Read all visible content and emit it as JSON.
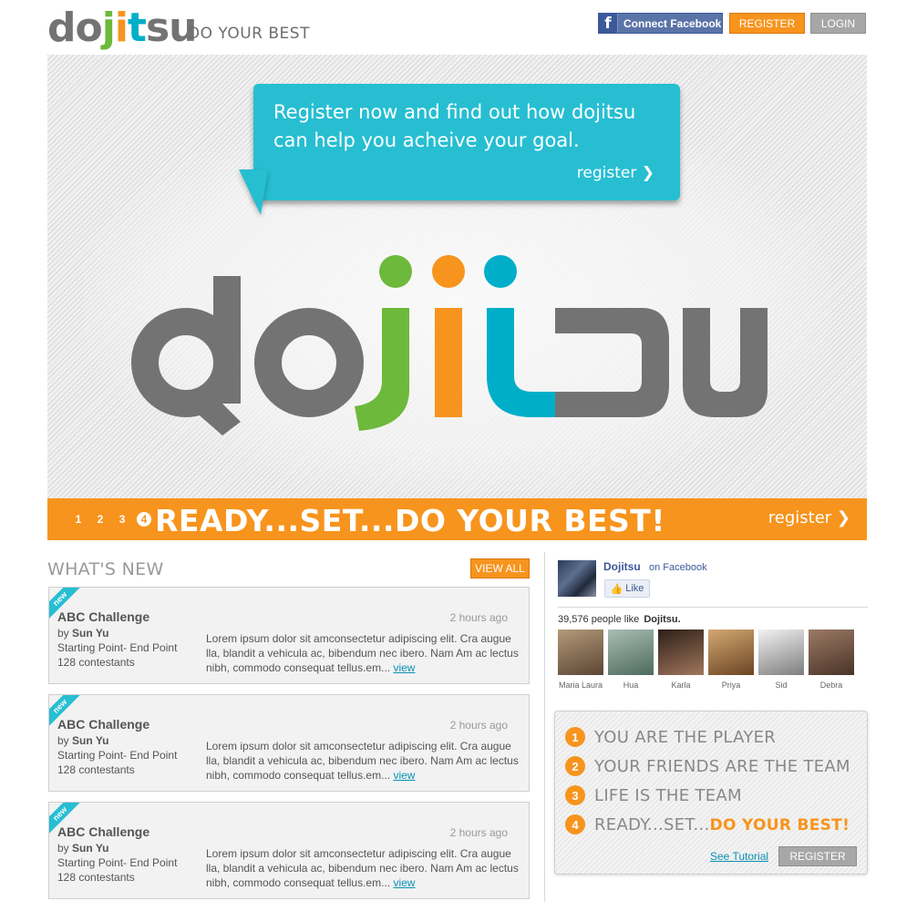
{
  "header": {
    "logo": {
      "d": "do",
      "j": "j",
      "i": "i",
      "t": "t",
      "su": "su"
    },
    "tagline": "DO YOUR BEST",
    "facebook_button": "Connect Facebook",
    "register_button": "REGISTER",
    "login_button": "LOGIN"
  },
  "hero": {
    "bubble_text": "Register now and find out how dojitsu can help you acheive your goal.",
    "bubble_link": "register ❯",
    "big_logo": {
      "do": "do",
      "j": "j",
      "i": "i",
      "t": "t",
      "su": "su"
    },
    "colors": {
      "gray": "#737373",
      "green": "#6cb93b",
      "orange": "#f7941d",
      "blue": "#00aec9"
    }
  },
  "slider": {
    "dots": [
      "1",
      "2",
      "3",
      "4"
    ],
    "active_dot": 4,
    "headline": "READY...SET...DO YOUR BEST!",
    "link": "register ❯"
  },
  "whats_new": {
    "title": "WHAT'S NEW",
    "view_all": "VIEW ALL",
    "items": [
      {
        "badge": "new",
        "title": "ABC Challenge",
        "time": "2 hours ago",
        "by_prefix": "by",
        "author": "Sun Yu",
        "route": "Starting Point- End Point",
        "contestants": "128 contestants",
        "description": "Lorem ipsum dolor sit amconsectetur adipiscing elit. Cra augue lla, blandit a vehicula ac, bibendum nec ibero. Nam Am ac lectus nibh, commodo consequat tellus.em...",
        "view": "view"
      },
      {
        "badge": "new",
        "title": "ABC Challenge",
        "time": "2 hours ago",
        "by_prefix": "by",
        "author": "Sun Yu",
        "route": "Starting Point- End Point",
        "contestants": "128 contestants",
        "description": "Lorem ipsum dolor sit amconsectetur adipiscing elit. Cra augue lla, blandit a vehicula ac, bibendum nec ibero. Nam Am ac lectus nibh, commodo consequat tellus.em...",
        "view": "view"
      },
      {
        "badge": "new",
        "title": "ABC Challenge",
        "time": "2 hours ago",
        "by_prefix": "by",
        "author": "Sun Yu",
        "route": "Starting Point- End Point",
        "contestants": "128 contestants",
        "description": "Lorem ipsum dolor sit amconsectetur adipiscing elit. Cra augue lla, blandit a vehicula ac, bibendum nec ibero. Nam Am ac lectus nibh, commodo consequat tellus.em...",
        "view": "view"
      }
    ]
  },
  "facebook": {
    "page_name": "Dojitsu",
    "on_facebook": "on Facebook",
    "like_button": "Like",
    "likes_count": "39,576 people like",
    "likes_page": "Dojitsu.",
    "friends": [
      {
        "name": "Maria Laura",
        "color": "#8a7358"
      },
      {
        "name": "Hua",
        "color": "#6f8a80"
      },
      {
        "name": "Karla",
        "color": "#4a3226"
      },
      {
        "name": "Priya",
        "color": "#9a6b3c"
      },
      {
        "name": "Sid",
        "color": "#cfcfcf"
      },
      {
        "name": "Debra",
        "color": "#7a5a4a"
      }
    ]
  },
  "steps": {
    "items": [
      {
        "num": "1",
        "text": "YOU ARE THE PLAYER",
        "highlight": ""
      },
      {
        "num": "2",
        "text": "YOUR FRIENDS ARE THE TEAM",
        "highlight": ""
      },
      {
        "num": "3",
        "text": "LIFE IS THE TEAM",
        "highlight": ""
      },
      {
        "num": "4",
        "text": "READY...SET...",
        "highlight": "DO YOUR BEST!"
      }
    ],
    "see_tutorial": "See Tutorial",
    "register_button": "REGISTER"
  }
}
